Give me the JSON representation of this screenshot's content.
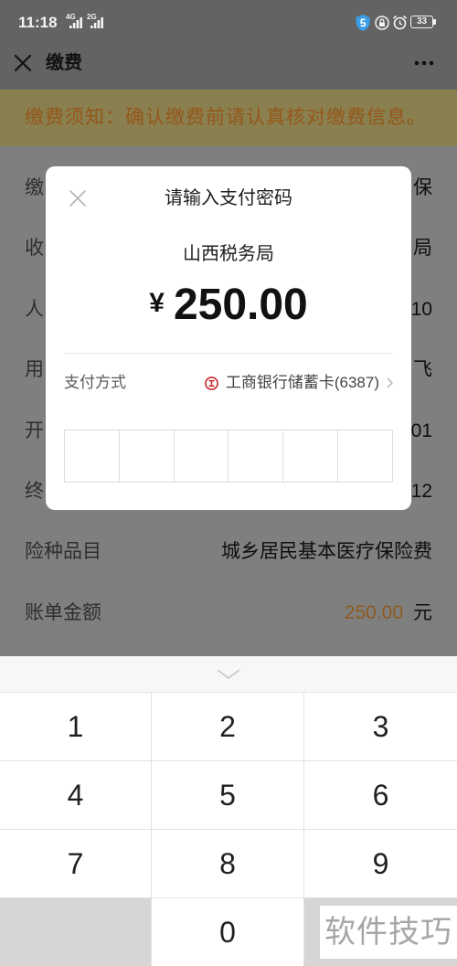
{
  "status_bar": {
    "time": "11:18",
    "signal_1": "4G",
    "signal_2": "2G",
    "battery": "33",
    "icons": {
      "signal": "signal-bars-icon",
      "security": "shield-icon",
      "lock": "lock-icon",
      "alarm": "alarm-icon",
      "battery": "battery-icon"
    }
  },
  "header": {
    "title": "缴费",
    "close_icon": "close-icon",
    "more_icon": "more-icon"
  },
  "notice": {
    "text": "缴费须知：确认缴费前请认真核对缴费信息。"
  },
  "info_rows": [
    {
      "label": "缴",
      "value": "保"
    },
    {
      "label": "收",
      "value": "局"
    },
    {
      "label": "人",
      "value": "10"
    },
    {
      "label": "用",
      "value": "飞"
    },
    {
      "label": "开",
      "value": "01"
    },
    {
      "label": "终",
      "value": "12"
    },
    {
      "label": "险种品目",
      "value": "城乡居民基本医疗保险费"
    },
    {
      "label": "账单金额",
      "value": "250.00",
      "unit": "元"
    }
  ],
  "dialog": {
    "title": "请输入支付密码",
    "close_icon": "close-icon",
    "payee": "山西税务局",
    "currency_symbol": "¥",
    "amount": "250.00",
    "payment_method_label": "支付方式",
    "payment_method_value": "工商银行储蓄卡(6387)",
    "bank_icon": "icbc-bank-icon",
    "chevron_icon": "chevron-right-icon"
  },
  "keypad": {
    "collapse_icon": "chevron-down-icon",
    "keys": [
      [
        "1",
        "2",
        "3"
      ],
      [
        "4",
        "5",
        "6"
      ],
      [
        "7",
        "8",
        "9"
      ],
      [
        "",
        "0",
        ""
      ]
    ]
  },
  "watermark": {
    "text": "软件技巧"
  },
  "colors": {
    "chrome_bg": "#636363",
    "page_bg": "#7f7f7f",
    "notice_bg": "#8a7f4f",
    "notice_text": "#95571a",
    "amount_orange": "#8c5c1e",
    "bank_red": "#c8262c",
    "keypad_bg": "#f7f7f7",
    "blank_key_bg": "#d6d6d6"
  }
}
